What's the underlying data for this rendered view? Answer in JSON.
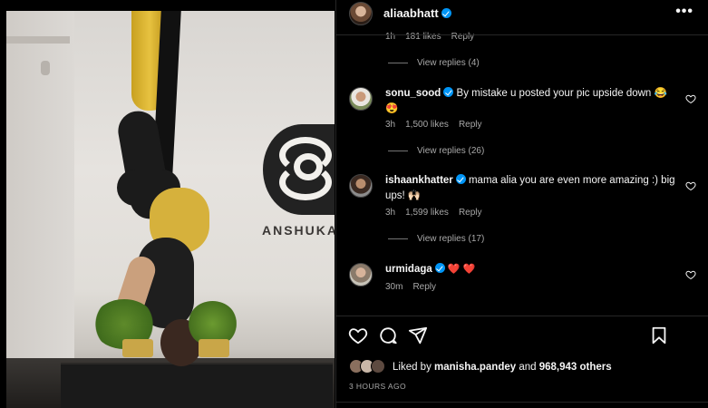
{
  "post": {
    "username": "aliaabhatt",
    "more_label": "•••",
    "photo_logo_text": "ANSHUKA YO"
  },
  "top_meta": {
    "time": "1h",
    "likes": "181 likes",
    "reply": "Reply",
    "view_replies": "View replies (4)"
  },
  "comments": [
    {
      "username": "sonu_sood",
      "verified": true,
      "text": " By mistake u posted your pic upside down 😂 😍",
      "time": "3h",
      "likes": "1,500 likes",
      "reply": "Reply",
      "view_replies": "View replies (26)"
    },
    {
      "username": "ishaankhatter",
      "verified": true,
      "text": " mama alia you are even more amazing :) big ups! 🙌🏻",
      "time": "3h",
      "likes": "1,599 likes",
      "reply": "Reply",
      "view_replies": "View replies (17)"
    },
    {
      "username": "urmidaga",
      "verified": true,
      "text": " ❤️ ❤️",
      "time": "30m",
      "reply": "Reply"
    }
  ],
  "actions": {
    "like_icon": "heart-outline-icon",
    "comment_icon": "comment-bubble-icon",
    "share_icon": "paper-plane-icon",
    "save_icon": "bookmark-icon"
  },
  "likes_summary": {
    "prefix": "Liked by ",
    "liker": "manisha.pandey",
    "middle": " and ",
    "count": "968,943 others"
  },
  "timestamp": "3 HOURS AGO",
  "colors": {
    "background": "#000000",
    "verified": "#0095f6",
    "secondary_text": "#a8a8a8",
    "divider": "#262626",
    "heart_red": "#ed4956"
  }
}
